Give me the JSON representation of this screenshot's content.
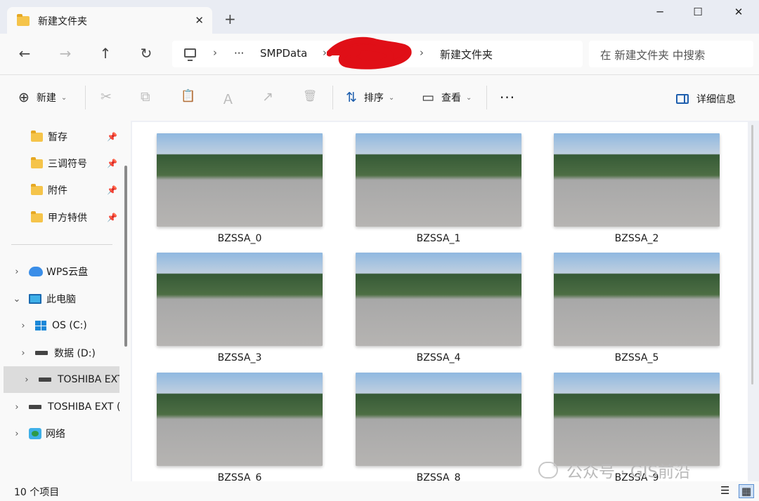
{
  "tab": {
    "title": "新建文件夹",
    "close": "✕",
    "new_tab": "+"
  },
  "window": {
    "minimize": "─",
    "maximize": "☐",
    "close": "✕"
  },
  "nav": {
    "back": "←",
    "forward": "→",
    "up": "↑",
    "refresh": "↻"
  },
  "address": {
    "ellipsis": "···",
    "crumbs": [
      "SMPData",
      "新建文件夹"
    ],
    "sep": "›"
  },
  "search": {
    "placeholder": "在 新建文件夹 中搜索"
  },
  "toolbar": {
    "new_label": "新建",
    "new_glyph": "⊕",
    "cut": "✂",
    "copy": "⧉",
    "paste": "📋",
    "rename": "Ａ",
    "share": "↗",
    "delete": "🗑",
    "sort_label": "排序",
    "sort_glyph": "⇅",
    "view_label": "查看",
    "view_glyph": "▭",
    "more": "···",
    "details_label": "详细信息",
    "caret": "⌄"
  },
  "sidebar": {
    "quick": [
      {
        "label": "暂存"
      },
      {
        "label": "三调符号"
      },
      {
        "label": "附件"
      },
      {
        "label": "甲方特供"
      }
    ],
    "pin": "📌",
    "wps": "WPS云盘",
    "thispc": "此电脑",
    "drive_c": "OS (C:)",
    "drive_d": "数据 (D:)",
    "toshiba_sel": "TOSHIBA EXT",
    "toshiba": "TOSHIBA EXT (",
    "network": "网络",
    "chev_right": "›",
    "chev_down": "⌄"
  },
  "files": [
    "BZSSA_0",
    "BZSSA_1",
    "BZSSA_2",
    "BZSSA_3",
    "BZSSA_4",
    "BZSSA_5",
    "BZSSA_6",
    "BZSSA_8",
    "BZSSA_9"
  ],
  "status": {
    "count": "10 个项目",
    "list_icon": "☰",
    "grid_icon": "▦"
  },
  "watermark": "公众号 · GIS前沿",
  "colors": {
    "accent": "#1f5fae",
    "folder": "#f5c44a",
    "selected": "#dcdcdc"
  }
}
